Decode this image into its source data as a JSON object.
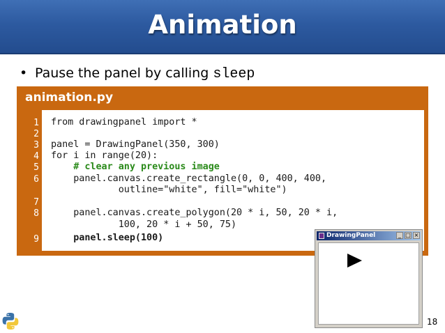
{
  "slide": {
    "title": "Animation",
    "bullet_text": "Pause the panel by calling ",
    "bullet_code": "sleep",
    "page_number": "18"
  },
  "code_box": {
    "filename": "animation.py",
    "lines": [
      {
        "num": "1",
        "text": "from drawingpanel import *"
      },
      {
        "num": "2",
        "text": ""
      },
      {
        "num": "3",
        "text": "panel = DrawingPanel(350, 300)"
      },
      {
        "num": "4",
        "text": "for i in range(20):"
      },
      {
        "num": "5",
        "text": "    # clear any previous image"
      },
      {
        "num": "6",
        "text": "    panel.canvas.create_rectangle(0, 0, 400, 400,"
      },
      {
        "num": "",
        "text": "            outline=\"white\", fill=\"white\")"
      },
      {
        "num": "7",
        "text": ""
      },
      {
        "num": "8",
        "text": "    panel.canvas.create_polygon(20 * i, 50, 20 * i,"
      },
      {
        "num": "",
        "text": "            100, 20 * i + 50, 75)"
      },
      {
        "num": "9",
        "text": "    panel.sleep(100)"
      }
    ]
  },
  "drawing_window": {
    "title": "DrawingPanel",
    "minimize_glyph": "_",
    "maximize_glyph": "□",
    "close_glyph": "×"
  },
  "colors": {
    "title_bar": "#2d5aa0",
    "code_frame": "#c96810",
    "comment": "#2a8a1a"
  }
}
